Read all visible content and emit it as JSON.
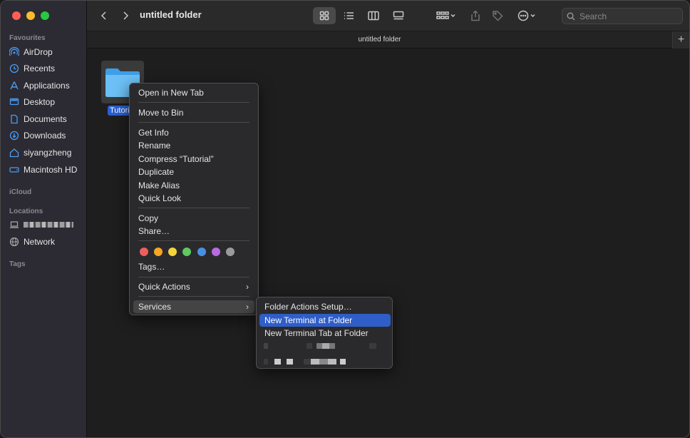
{
  "window": {
    "title": "untitled folder",
    "tab_title": "untitled folder",
    "tab_add": "+"
  },
  "search": {
    "placeholder": "Search"
  },
  "sidebar": {
    "favourites_header": "Favourites",
    "favourites": [
      {
        "label": "AirDrop",
        "icon": "airdrop-icon"
      },
      {
        "label": "Recents",
        "icon": "clock-icon"
      },
      {
        "label": "Applications",
        "icon": "applications-icon"
      },
      {
        "label": "Desktop",
        "icon": "desktop-icon"
      },
      {
        "label": "Documents",
        "icon": "document-icon"
      },
      {
        "label": "Downloads",
        "icon": "download-icon"
      },
      {
        "label": "siyangzheng",
        "icon": "home-icon"
      },
      {
        "label": "Macintosh HD",
        "icon": "drive-icon"
      }
    ],
    "icloud_header": "iCloud",
    "locations_header": "Locations",
    "locations": [
      {
        "label": "",
        "icon": "laptop-icon",
        "redacted": true
      },
      {
        "label": "Network",
        "icon": "network-icon"
      }
    ],
    "tags_header": "Tags"
  },
  "content": {
    "folder_name": "Tutorial"
  },
  "context_menu": {
    "items": [
      {
        "label": "Open in New Tab"
      },
      {
        "label": "Move to Bin"
      },
      {
        "label": "Get Info"
      },
      {
        "label": "Rename"
      },
      {
        "label": "Compress “Tutorial”"
      },
      {
        "label": "Duplicate"
      },
      {
        "label": "Make Alias"
      },
      {
        "label": "Quick Look"
      },
      {
        "label": "Copy"
      },
      {
        "label": "Share…"
      },
      {
        "label": "Tags…"
      },
      {
        "label": "Quick Actions"
      },
      {
        "label": "Services"
      }
    ],
    "tag_colors": [
      "#ec5f5f",
      "#f5a623",
      "#f3d33b",
      "#5ec95e",
      "#4a90e2",
      "#b86be0",
      "#9a9a9a"
    ],
    "chevron": "›"
  },
  "services_submenu": {
    "items": [
      {
        "label": "Folder Actions Setup…"
      },
      {
        "label": "New Terminal at Folder"
      },
      {
        "label": "New Terminal Tab at Folder"
      }
    ]
  }
}
